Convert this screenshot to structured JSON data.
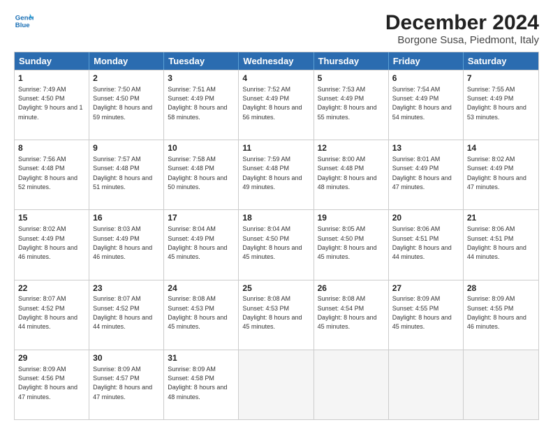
{
  "logo": {
    "line1": "General",
    "line2": "Blue"
  },
  "title": "December 2024",
  "location": "Borgone Susa, Piedmont, Italy",
  "header_days": [
    "Sunday",
    "Monday",
    "Tuesday",
    "Wednesday",
    "Thursday",
    "Friday",
    "Saturday"
  ],
  "weeks": [
    [
      {
        "day": "1",
        "rise": "Sunrise: 7:49 AM",
        "set": "Sunset: 4:50 PM",
        "daylight": "Daylight: 9 hours and 1 minute."
      },
      {
        "day": "2",
        "rise": "Sunrise: 7:50 AM",
        "set": "Sunset: 4:50 PM",
        "daylight": "Daylight: 8 hours and 59 minutes."
      },
      {
        "day": "3",
        "rise": "Sunrise: 7:51 AM",
        "set": "Sunset: 4:49 PM",
        "daylight": "Daylight: 8 hours and 58 minutes."
      },
      {
        "day": "4",
        "rise": "Sunrise: 7:52 AM",
        "set": "Sunset: 4:49 PM",
        "daylight": "Daylight: 8 hours and 56 minutes."
      },
      {
        "day": "5",
        "rise": "Sunrise: 7:53 AM",
        "set": "Sunset: 4:49 PM",
        "daylight": "Daylight: 8 hours and 55 minutes."
      },
      {
        "day": "6",
        "rise": "Sunrise: 7:54 AM",
        "set": "Sunset: 4:49 PM",
        "daylight": "Daylight: 8 hours and 54 minutes."
      },
      {
        "day": "7",
        "rise": "Sunrise: 7:55 AM",
        "set": "Sunset: 4:49 PM",
        "daylight": "Daylight: 8 hours and 53 minutes."
      }
    ],
    [
      {
        "day": "8",
        "rise": "Sunrise: 7:56 AM",
        "set": "Sunset: 4:48 PM",
        "daylight": "Daylight: 8 hours and 52 minutes."
      },
      {
        "day": "9",
        "rise": "Sunrise: 7:57 AM",
        "set": "Sunset: 4:48 PM",
        "daylight": "Daylight: 8 hours and 51 minutes."
      },
      {
        "day": "10",
        "rise": "Sunrise: 7:58 AM",
        "set": "Sunset: 4:48 PM",
        "daylight": "Daylight: 8 hours and 50 minutes."
      },
      {
        "day": "11",
        "rise": "Sunrise: 7:59 AM",
        "set": "Sunset: 4:48 PM",
        "daylight": "Daylight: 8 hours and 49 minutes."
      },
      {
        "day": "12",
        "rise": "Sunrise: 8:00 AM",
        "set": "Sunset: 4:48 PM",
        "daylight": "Daylight: 8 hours and 48 minutes."
      },
      {
        "day": "13",
        "rise": "Sunrise: 8:01 AM",
        "set": "Sunset: 4:49 PM",
        "daylight": "Daylight: 8 hours and 47 minutes."
      },
      {
        "day": "14",
        "rise": "Sunrise: 8:02 AM",
        "set": "Sunset: 4:49 PM",
        "daylight": "Daylight: 8 hours and 47 minutes."
      }
    ],
    [
      {
        "day": "15",
        "rise": "Sunrise: 8:02 AM",
        "set": "Sunset: 4:49 PM",
        "daylight": "Daylight: 8 hours and 46 minutes."
      },
      {
        "day": "16",
        "rise": "Sunrise: 8:03 AM",
        "set": "Sunset: 4:49 PM",
        "daylight": "Daylight: 8 hours and 46 minutes."
      },
      {
        "day": "17",
        "rise": "Sunrise: 8:04 AM",
        "set": "Sunset: 4:49 PM",
        "daylight": "Daylight: 8 hours and 45 minutes."
      },
      {
        "day": "18",
        "rise": "Sunrise: 8:04 AM",
        "set": "Sunset: 4:50 PM",
        "daylight": "Daylight: 8 hours and 45 minutes."
      },
      {
        "day": "19",
        "rise": "Sunrise: 8:05 AM",
        "set": "Sunset: 4:50 PM",
        "daylight": "Daylight: 8 hours and 45 minutes."
      },
      {
        "day": "20",
        "rise": "Sunrise: 8:06 AM",
        "set": "Sunset: 4:51 PM",
        "daylight": "Daylight: 8 hours and 44 minutes."
      },
      {
        "day": "21",
        "rise": "Sunrise: 8:06 AM",
        "set": "Sunset: 4:51 PM",
        "daylight": "Daylight: 8 hours and 44 minutes."
      }
    ],
    [
      {
        "day": "22",
        "rise": "Sunrise: 8:07 AM",
        "set": "Sunset: 4:52 PM",
        "daylight": "Daylight: 8 hours and 44 minutes."
      },
      {
        "day": "23",
        "rise": "Sunrise: 8:07 AM",
        "set": "Sunset: 4:52 PM",
        "daylight": "Daylight: 8 hours and 44 minutes."
      },
      {
        "day": "24",
        "rise": "Sunrise: 8:08 AM",
        "set": "Sunset: 4:53 PM",
        "daylight": "Daylight: 8 hours and 45 minutes."
      },
      {
        "day": "25",
        "rise": "Sunrise: 8:08 AM",
        "set": "Sunset: 4:53 PM",
        "daylight": "Daylight: 8 hours and 45 minutes."
      },
      {
        "day": "26",
        "rise": "Sunrise: 8:08 AM",
        "set": "Sunset: 4:54 PM",
        "daylight": "Daylight: 8 hours and 45 minutes."
      },
      {
        "day": "27",
        "rise": "Sunrise: 8:09 AM",
        "set": "Sunset: 4:55 PM",
        "daylight": "Daylight: 8 hours and 45 minutes."
      },
      {
        "day": "28",
        "rise": "Sunrise: 8:09 AM",
        "set": "Sunset: 4:55 PM",
        "daylight": "Daylight: 8 hours and 46 minutes."
      }
    ],
    [
      {
        "day": "29",
        "rise": "Sunrise: 8:09 AM",
        "set": "Sunset: 4:56 PM",
        "daylight": "Daylight: 8 hours and 47 minutes."
      },
      {
        "day": "30",
        "rise": "Sunrise: 8:09 AM",
        "set": "Sunset: 4:57 PM",
        "daylight": "Daylight: 8 hours and 47 minutes."
      },
      {
        "day": "31",
        "rise": "Sunrise: 8:09 AM",
        "set": "Sunset: 4:58 PM",
        "daylight": "Daylight: 8 hours and 48 minutes."
      },
      {
        "day": "",
        "rise": "",
        "set": "",
        "daylight": ""
      },
      {
        "day": "",
        "rise": "",
        "set": "",
        "daylight": ""
      },
      {
        "day": "",
        "rise": "",
        "set": "",
        "daylight": ""
      },
      {
        "day": "",
        "rise": "",
        "set": "",
        "daylight": ""
      }
    ]
  ]
}
